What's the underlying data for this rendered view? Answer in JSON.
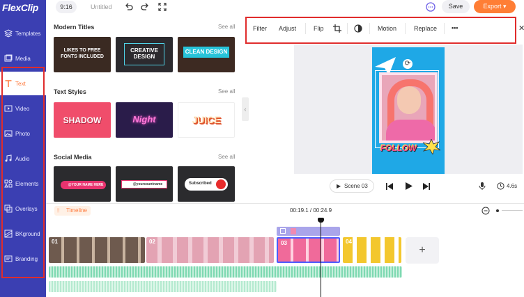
{
  "app": {
    "logo": "FlexClip",
    "brand_color": "#3b3fb2",
    "accent_color": "#ff7e35"
  },
  "topbar": {
    "ratio": "9:16",
    "title": "Untitled",
    "save_label": "Save",
    "export_label": "Export"
  },
  "sidebar": {
    "items": [
      {
        "label": "Templates",
        "icon": "templates-icon"
      },
      {
        "label": "Media",
        "icon": "media-icon"
      },
      {
        "label": "Text",
        "icon": "text-icon",
        "active": true
      },
      {
        "label": "Video",
        "icon": "video-icon"
      },
      {
        "label": "Photo",
        "icon": "photo-icon"
      },
      {
        "label": "Audio",
        "icon": "audio-icon"
      },
      {
        "label": "Elements",
        "icon": "elements-icon"
      },
      {
        "label": "Overlays",
        "icon": "overlays-icon"
      },
      {
        "label": "BKground",
        "icon": "background-icon"
      },
      {
        "label": "Branding",
        "icon": "branding-icon"
      }
    ]
  },
  "panel": {
    "sections": [
      {
        "title": "Modern Titles",
        "see_all": "See all",
        "tiles": [
          {
            "text": "LIKES TO FREE\nFONTS INCLUDED"
          },
          {
            "text": "CREATIVE\nDESIGN"
          },
          {
            "text": "CLEAN DESIGN"
          }
        ]
      },
      {
        "title": "Text Styles",
        "see_all": "See all",
        "tiles": [
          {
            "text": "SHADOW"
          },
          {
            "text": "Night"
          },
          {
            "text": "JUICE"
          }
        ]
      },
      {
        "title": "Social Media",
        "see_all": "See all",
        "tiles": [
          {
            "text": "@YOUR NAME HERE"
          },
          {
            "text": "@yourcountname"
          },
          {
            "text": "Subscribed"
          }
        ]
      }
    ]
  },
  "toolbar": {
    "filter": "Filter",
    "adjust": "Adjust",
    "flip": "Flip",
    "motion": "Motion",
    "replace": "Replace",
    "more": "•••"
  },
  "canvas": {
    "sticker_text": "FOLLOW"
  },
  "player": {
    "scene": "Scene 03",
    "duration": "4.6s"
  },
  "timeline": {
    "label": "Timeline",
    "timecode": "00:19.1 / 00:24.9",
    "clips": [
      {
        "num": "01"
      },
      {
        "num": "02"
      },
      {
        "num": "03"
      },
      {
        "num": "04"
      }
    ],
    "add_label": "+"
  }
}
